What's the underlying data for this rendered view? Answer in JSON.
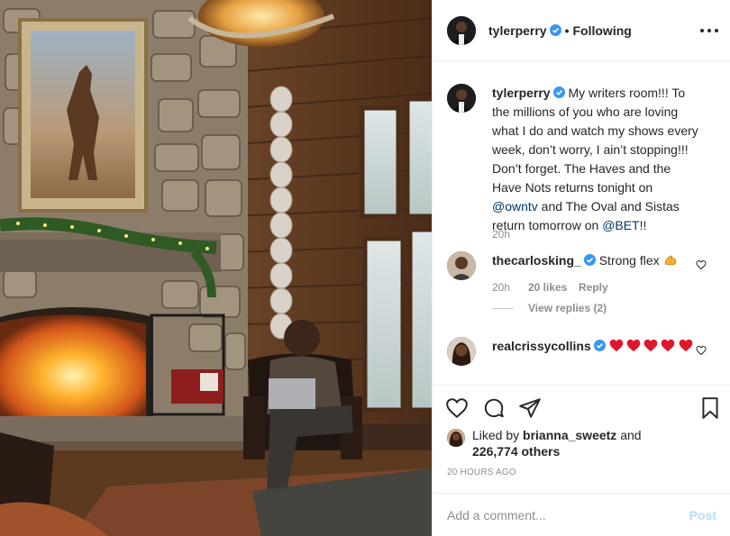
{
  "post_header": {
    "username": "tylerperry",
    "separator": "•",
    "follow_status": "Following",
    "more_icon": "more-horizontal-icon"
  },
  "caption": {
    "username": "tylerperry",
    "text_1": "My writers room!!! To the millions of you who are loving what I do and watch my shows every week, don’t worry, I ain’t stopping!!! Don’t forget. The Haves and the Have Nots returns tonight on ",
    "mention_1": "@owntv",
    "text_2": " and The Oval and Sistas return tomorrow on ",
    "mention_2": "@BET",
    "text_3": "!!",
    "time": "20h"
  },
  "comments": [
    {
      "username": "thecarlosking_",
      "text": "Strong flex",
      "emoji_icon": "flexed-biceps-icon",
      "time": "20h",
      "likes": "20 likes",
      "reply_label": "Reply",
      "view_replies": "View replies (2)"
    },
    {
      "username": "realcrissycollins",
      "emoji_icons": [
        "red-heart-icon",
        "red-heart-icon",
        "red-heart-icon",
        "red-heart-icon",
        "red-heart-icon"
      ]
    }
  ],
  "actions": {
    "icons": [
      "heart-outline-icon",
      "comment-icon",
      "share-icon",
      "bookmark-icon"
    ]
  },
  "likes": {
    "prefix": "Liked by ",
    "user": "brianna_sweetz",
    "middle": " and",
    "count": "226,774 others"
  },
  "timestamp": "20 HOURS AGO",
  "add_comment": {
    "placeholder": "Add a comment...",
    "post_label": "Post"
  },
  "colors": {
    "verified": "#3897f0",
    "link": "#00376b",
    "muted": "#8e8e8e",
    "post_disabled": "#b2dffc",
    "heart": "#ed4956"
  }
}
